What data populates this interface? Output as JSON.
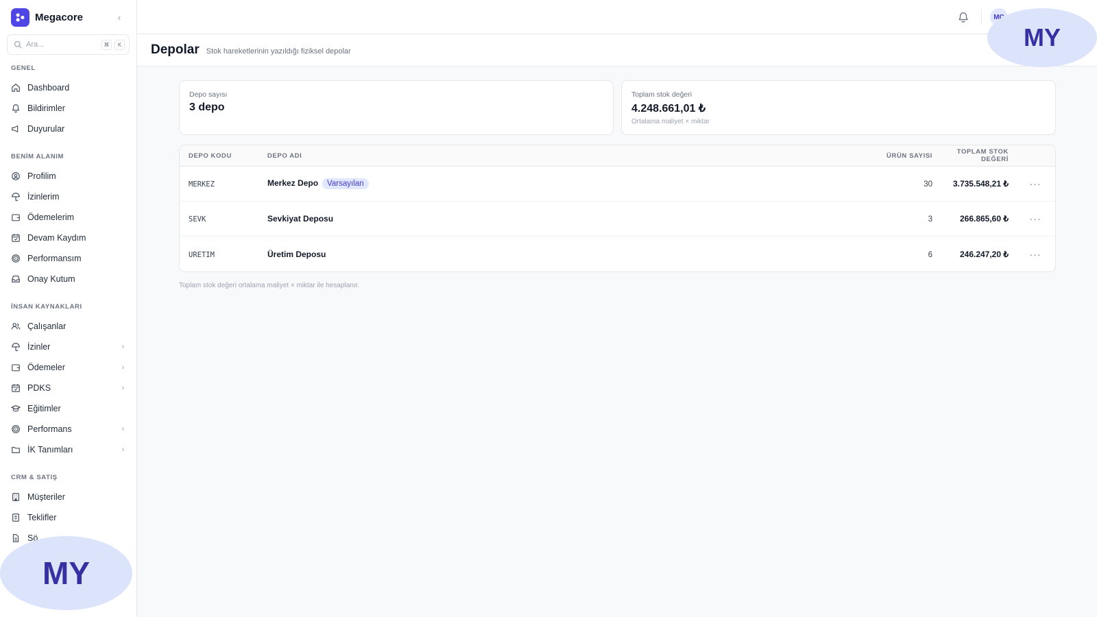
{
  "app": {
    "name": "Megacore"
  },
  "search": {
    "placeholder": "Ara...",
    "key1": "⌘",
    "key2": "K"
  },
  "sidebar": {
    "sections": [
      {
        "title": "GENEL",
        "items": [
          {
            "label": "Dashboard",
            "icon": "home-icon"
          },
          {
            "label": "Bildirimler",
            "icon": "bell-icon"
          },
          {
            "label": "Duyurular",
            "icon": "megaphone-icon"
          }
        ]
      },
      {
        "title": "BENİM ALANIM",
        "items": [
          {
            "label": "Profilim",
            "icon": "user-circle-icon"
          },
          {
            "label": "İzinlerim",
            "icon": "umbrella-icon"
          },
          {
            "label": "Ödemelerim",
            "icon": "wallet-icon"
          },
          {
            "label": "Devam Kaydım",
            "icon": "calendar-icon"
          },
          {
            "label": "Performansım",
            "icon": "target-icon"
          },
          {
            "label": "Onay Kutum",
            "icon": "inbox-icon"
          }
        ]
      },
      {
        "title": "İNSAN KAYNAKLARI",
        "items": [
          {
            "label": "Çalışanlar",
            "icon": "users-icon"
          },
          {
            "label": "İzinler",
            "icon": "umbrella-icon"
          },
          {
            "label": "Ödemeler",
            "icon": "wallet-icon"
          },
          {
            "label": "PDKS",
            "icon": "calendar-icon"
          },
          {
            "label": "Eğitimler",
            "icon": "graduation-cap-icon"
          },
          {
            "label": "Performans",
            "icon": "target-icon"
          },
          {
            "label": "İK Tanımları",
            "icon": "folder-icon"
          }
        ]
      },
      {
        "title": "CRM & SATIŞ",
        "items": [
          {
            "label": "Müşteriler",
            "icon": "building-icon"
          },
          {
            "label": "Teklifler",
            "icon": "receipt-icon"
          },
          {
            "label": "Sö",
            "icon": "document-icon"
          }
        ]
      }
    ]
  },
  "topbar": {
    "avatar_initials": "MC"
  },
  "page": {
    "title": "Depolar",
    "subtitle": "Stok hareketlerinin yazıldığı fiziksel depolar"
  },
  "stats": {
    "count": {
      "label": "Depo sayısı",
      "value": "3 depo"
    },
    "total": {
      "label": "Toplam stok değeri",
      "value": "4.248.661,01 ₺",
      "note": "Ortalama maliyet × miktar"
    }
  },
  "table": {
    "headers": {
      "code": "DEPO KODU",
      "name": "DEPO ADI",
      "count": "ÜRÜN SAYISI",
      "total": "TOPLAM STOK DEĞERİ"
    },
    "rows": [
      {
        "code": "MERKEZ",
        "name": "Merkez Depo",
        "badge": "Varsayılan",
        "count": "30",
        "total": "3.735.548,21 ₺"
      },
      {
        "code": "SEVK",
        "name": "Sevkiyat Deposu",
        "badge": "",
        "count": "3",
        "total": "266.865,60 ₺"
      },
      {
        "code": "URETIM",
        "name": "Üretim Deposu",
        "badge": "",
        "count": "6",
        "total": "246.247,20 ₺"
      }
    ],
    "more_glyph": "···"
  },
  "footnote": "Toplam stok değeri ortalama maliyet × miktar ile hesaplanır.",
  "watermark": {
    "text": "MY"
  },
  "colors": {
    "accent": "#4f46e5",
    "badge_bg": "#e0e7ff",
    "badge_text": "#4338ca"
  }
}
